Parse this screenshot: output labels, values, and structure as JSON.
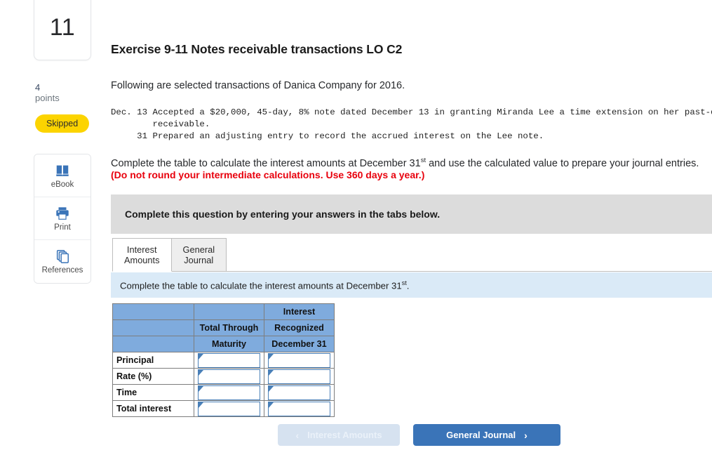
{
  "question": {
    "number": "11",
    "points_value": "4",
    "points_label": "points",
    "status_badge": "Skipped"
  },
  "tools": [
    {
      "label": "eBook",
      "icon": "ebook-icon"
    },
    {
      "label": "Print",
      "icon": "print-icon"
    },
    {
      "label": "References",
      "icon": "references-icon"
    }
  ],
  "exercise": {
    "title": "Exercise 9-11 Notes receivable transactions LO C2",
    "intro": "Following are selected transactions of Danica Company for 2016.",
    "transactions_text": "Dec. 13 Accepted a $20,000, 45-day, 8% note dated December 13 in granting Miranda Lee a time extension on her past-due accounts\n        receivable.\n     31 Prepared an adjusting entry to record the accrued interest on the Lee note.",
    "instruction_pre": "Complete the table to calculate the interest amounts at December 31",
    "instruction_sup": "st",
    "instruction_post": " and use the calculated value to prepare your journal entries.",
    "red_note": "(Do not round your intermediate calculations. Use 360 days a year.)"
  },
  "gray_bar": {
    "text": "Complete this question by entering your answers in the tabs below."
  },
  "tabs": [
    {
      "line1": "Interest",
      "line2": "Amounts",
      "active": true
    },
    {
      "line1": "General",
      "line2": "Journal",
      "active": false
    }
  ],
  "blue_banner": {
    "pre": "Complete the table to calculate the interest amounts at December 31",
    "sup": "st",
    "post": "."
  },
  "table": {
    "header_rows": [
      {
        "c1": "",
        "c2": "",
        "c3": "Interest"
      },
      {
        "c1": "",
        "c2": "Total Through",
        "c3": "Recognized"
      },
      {
        "c1": "",
        "c2": "Maturity",
        "c3": "December 31"
      }
    ],
    "rows": [
      {
        "label": "Principal",
        "total_through_maturity": "",
        "interest_recognized": ""
      },
      {
        "label": "Rate (%)",
        "total_through_maturity": "",
        "interest_recognized": ""
      },
      {
        "label": "Time",
        "total_through_maturity": "",
        "interest_recognized": ""
      },
      {
        "label": "Total interest",
        "total_through_maturity": "",
        "interest_recognized": ""
      }
    ]
  },
  "nav": {
    "prev_label": "Interest Amounts",
    "prev_chevron": "‹",
    "next_label": "General Journal",
    "next_chevron": "›"
  },
  "colors": {
    "table_header_blue": "#7FABDD",
    "primary_button_blue": "#3A74B8",
    "disabled_button_blue": "#d6e2f0",
    "banner_blue": "#daeaf7",
    "gray_bar": "#dcdcdc",
    "badge_yellow": "#FCD400",
    "red_text": "#e8000d",
    "icon_blue": "#3A74B8"
  }
}
